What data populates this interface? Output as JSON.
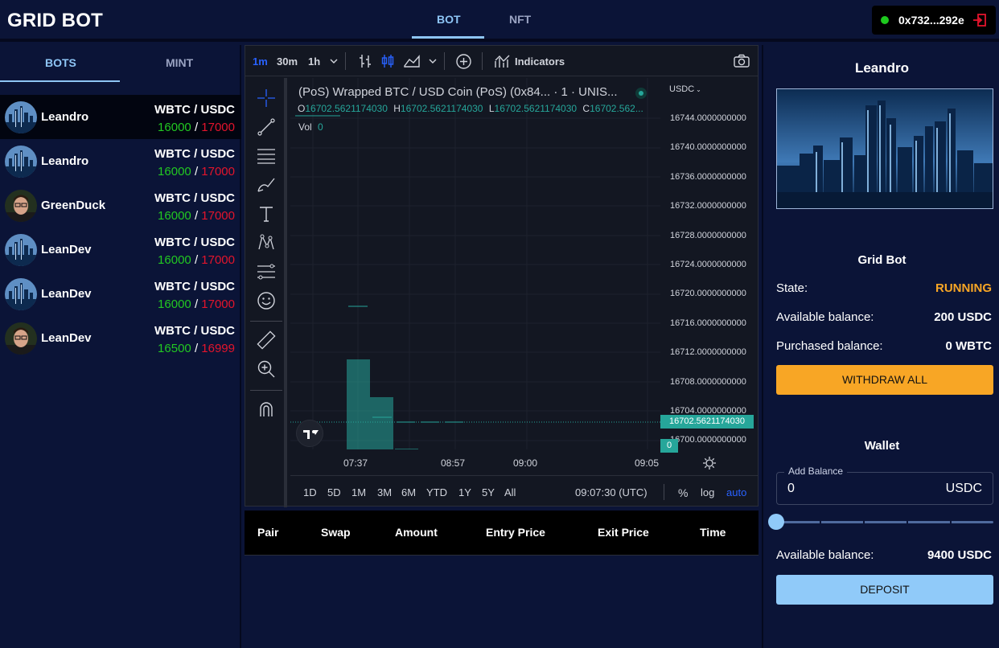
{
  "app": {
    "title": "GRID BOT"
  },
  "nav": {
    "tabs": [
      {
        "label": "BOT"
      },
      {
        "label": "NFT"
      }
    ]
  },
  "wallet": {
    "address": "0x732...292e"
  },
  "sidebar": {
    "tabs": [
      {
        "label": "BOTS"
      },
      {
        "label": "MINT"
      }
    ],
    "bots": [
      {
        "name": "Leandro",
        "pair": "WBTC / USDC",
        "low": "16000",
        "high": "17000",
        "avatar": "city-avatar"
      },
      {
        "name": "Leandro",
        "pair": "WBTC / USDC",
        "low": "16000",
        "high": "17000",
        "avatar": "city-avatar"
      },
      {
        "name": "GreenDuck",
        "pair": "WBTC / USDC",
        "low": "16000",
        "high": "17000",
        "avatar": "person-avatar"
      },
      {
        "name": "LeanDev",
        "pair": "WBTC / USDC",
        "low": "16000",
        "high": "17000",
        "avatar": "city-avatar"
      },
      {
        "name": "LeanDev",
        "pair": "WBTC / USDC",
        "low": "16000",
        "high": "17000",
        "avatar": "city-avatar"
      },
      {
        "name": "LeanDev",
        "pair": "WBTC / USDC",
        "low": "16500",
        "high": "16999",
        "avatar": "person-avatar"
      }
    ],
    "separator": "/"
  },
  "chart": {
    "timeframes": [
      {
        "label": "1m"
      },
      {
        "label": "30m"
      },
      {
        "label": "1h"
      }
    ],
    "indicators_label": "Indicators",
    "legend_title": "(PoS) Wrapped BTC / USD Coin (PoS) (0x84... · 1 · UNIS...",
    "ohlc": {
      "o_label": "O",
      "o": "16702.5621174030",
      "h_label": "H",
      "h": "16702.5621174030",
      "l_label": "L",
      "l": "16702.5621174030",
      "c_label": "C",
      "c": "16702.562..."
    },
    "vol_label": "Vol",
    "vol_value": "0",
    "currency": "USDC",
    "y_ticks": [
      "16744.0000000000",
      "16740.0000000000",
      "16736.0000000000",
      "16732.0000000000",
      "16728.0000000000",
      "16724.0000000000",
      "16720.0000000000",
      "16716.0000000000",
      "16712.0000000000",
      "16708.0000000000",
      "16704.0000000000",
      "16700.0000000000"
    ],
    "last_price_tag": "16702.5621174030",
    "volume_tag": "0",
    "x_ticks": [
      "07:37",
      "08:57",
      "09:00",
      "09:05"
    ],
    "ranges": [
      "1D",
      "5D",
      "1M",
      "3M",
      "6M",
      "YTD",
      "1Y",
      "5Y",
      "All"
    ],
    "clock": "09:07:30 (UTC)",
    "scale_buttons": {
      "percent": "%",
      "log": "log",
      "auto": "auto"
    }
  },
  "trades": {
    "columns": [
      "Pair",
      "Swap",
      "Amount",
      "Entry Price",
      "Exit Price",
      "Time"
    ]
  },
  "details": {
    "title": "Leandro",
    "grid_bot_heading": "Grid Bot",
    "state_label": "State:",
    "state_value": "RUNNING",
    "available_label": "Available balance:",
    "available_value": "200 USDC",
    "purchased_label": "Purchased balance:",
    "purchased_value": "0 WBTC",
    "withdraw_label": "WITHDRAW ALL",
    "wallet_heading": "Wallet",
    "add_balance_label": "Add Balance",
    "add_balance_value": "0",
    "add_balance_unit": "USDC",
    "wallet_available_label": "Available balance:",
    "wallet_available_value": "9400 USDC",
    "deposit_label": "DEPOSIT",
    "slider_value": 0,
    "state_color": "#f8a625"
  }
}
